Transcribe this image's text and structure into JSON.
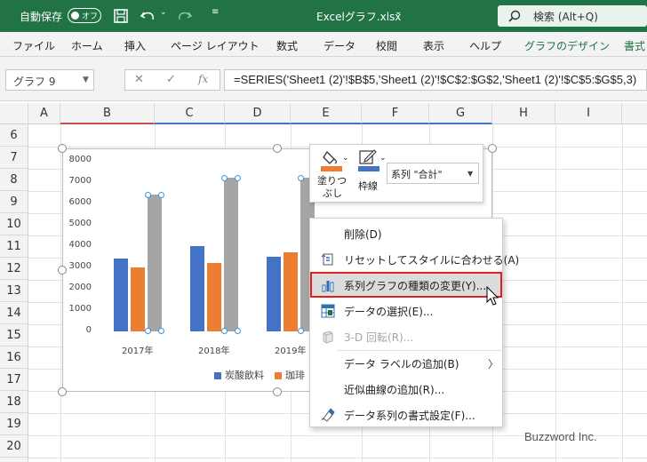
{
  "titlebar": {
    "autosave_label": "自動保存",
    "autosave_state": "オフ",
    "filename": "Excelグラフ.xlsx",
    "filename_dd": "⌄",
    "search": "検索 (Alt+Q)",
    "accent": "#217346"
  },
  "ribbon": {
    "tabs": [
      "ファイル",
      "ホーム",
      "挿入",
      "ページ レイアウト",
      "数式",
      "データ",
      "校閲",
      "表示",
      "ヘルプ",
      "グラフのデザイン",
      "書式"
    ]
  },
  "formula_bar": {
    "name_box": "グラフ 9",
    "cancel": "✕",
    "enter": "✓",
    "fx": "fx",
    "formula": "=SERIES('Sheet1 (2)'!$B$5,'Sheet1 (2)'!$C$2:$G$2,'Sheet1 (2)'!$C$5:$G$5,3)"
  },
  "columns": [
    "A",
    "B",
    "C",
    "D",
    "E",
    "F",
    "G",
    "H",
    "I"
  ],
  "rows": [
    "6",
    "7",
    "8",
    "9",
    "10",
    "11",
    "12",
    "13",
    "14",
    "15",
    "16",
    "17",
    "18",
    "19",
    "20"
  ],
  "chart_data": {
    "type": "bar",
    "categories": [
      "2017年",
      "2018年",
      "2019年"
    ],
    "y_ticks": [
      "8000",
      "7000",
      "6000",
      "5000",
      "4000",
      "3000",
      "2000",
      "1000",
      "0"
    ],
    "ylim": [
      0,
      8000
    ],
    "series": [
      {
        "name": "炭酸飲料",
        "color": "#4472c4",
        "values": [
          3400,
          4000,
          3500
        ]
      },
      {
        "name": "珈琲",
        "color": "#ed7d31",
        "values": [
          3000,
          3200,
          3700
        ]
      },
      {
        "name": "",
        "color": "#a5a5a5",
        "values": [
          6400,
          7200,
          7200
        ]
      }
    ],
    "legend_position": "bottom",
    "selected_series_index": 2
  },
  "mini_toolbar": {
    "fill_label_1": "塗りつ",
    "fill_label_2": "ぶし",
    "outline_label": "枠線",
    "series_select": "系列 \"合計\"",
    "fill_color": "#ed7d31",
    "outline_color": "#4472c4"
  },
  "context_menu": {
    "items": [
      {
        "label": "削除(D)",
        "icon": "none"
      },
      {
        "label": "リセットしてスタイルに合わせる(A)",
        "icon": "reset-style-icon"
      },
      {
        "label": "系列グラフの種類の変更(Y)...",
        "icon": "change-chart-type-icon",
        "highlighted": true
      },
      {
        "label": "データの選択(E)...",
        "icon": "select-data-icon"
      },
      {
        "label": "3-D 回転(R)...",
        "icon": "rotate-3d-icon",
        "disabled": true
      },
      {
        "label": "データ ラベルの追加(B)",
        "icon": "none",
        "submenu": "〉"
      },
      {
        "label": "近似曲線の追加(R)...",
        "icon": "none"
      },
      {
        "label": "データ系列の書式設定(F)...",
        "icon": "format-series-icon"
      }
    ]
  },
  "watermark": "Buzzword Inc."
}
